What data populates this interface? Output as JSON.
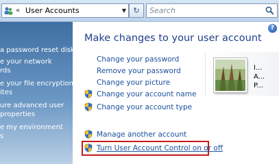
{
  "address_bar": {
    "nav_chevrons": "«",
    "breadcrumb": "User Accounts",
    "separator": "▸",
    "dropdown": "▼",
    "refresh": "↻"
  },
  "search": {
    "placeholder": "Search"
  },
  "left_pane": {
    "items": [
      {
        "line1": "a password reset disk",
        "line2": ""
      },
      {
        "line1": "e your network",
        "line2": "rds"
      },
      {
        "line1": "e your file encryption",
        "line2": "ites"
      },
      {
        "line1": "ure advanced user",
        "line2": "properties"
      },
      {
        "line1": "e my environment",
        "line2": "s"
      }
    ]
  },
  "main": {
    "help": "?",
    "title": "Make changes to your user account",
    "links": [
      {
        "label": "Change your password",
        "shield": false
      },
      {
        "label": "Remove your password",
        "shield": false
      },
      {
        "label": "Change your picture",
        "shield": false
      },
      {
        "label": "Change your account name",
        "shield": true
      },
      {
        "label": "Change your account type",
        "shield": true
      },
      {
        "label": "Manage another account",
        "shield": true
      },
      {
        "label": "Turn User Account Control on or off",
        "shield": true
      }
    ],
    "account": {
      "line1": "I...",
      "line2": "A...",
      "line3": "P..."
    }
  },
  "colors": {
    "link": "#1b4f9c",
    "title": "#1e3f8a",
    "highlight": "#c81818",
    "pane": "#3f6fa3"
  },
  "icons": {
    "address": "user-accounts-icon",
    "search": "magnifier-icon",
    "shield": "uac-shield-icon",
    "help": "help-icon"
  }
}
